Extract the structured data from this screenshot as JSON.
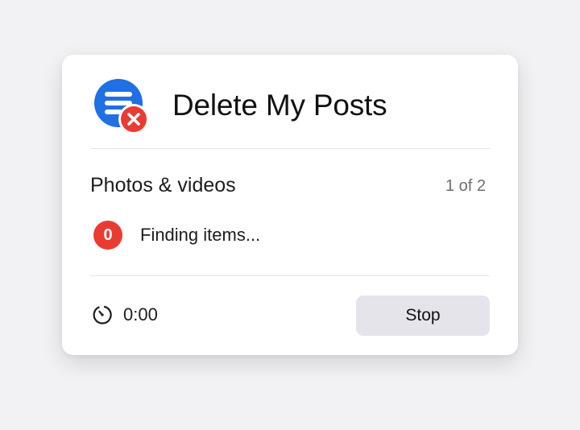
{
  "app": {
    "title": "Delete My Posts",
    "logo_icon": "list-delete-icon",
    "logo_color": "#1f6fe5",
    "logo_badge_color": "#ea3b32"
  },
  "section": {
    "title": "Photos & videos",
    "step_counter": "1 of 2"
  },
  "progress": {
    "count": "0",
    "count_badge_color": "#ea3b32",
    "status": "Finding items..."
  },
  "footer": {
    "timer_icon": "timer-icon",
    "timer_value": "0:00",
    "stop_label": "Stop"
  }
}
